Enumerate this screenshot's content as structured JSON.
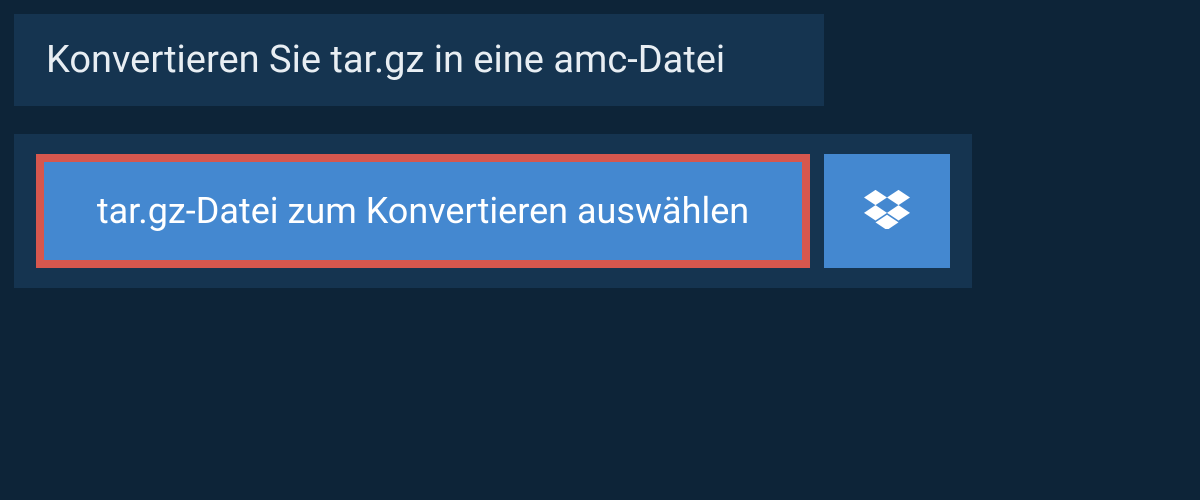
{
  "header": {
    "title": "Konvertieren Sie tar.gz in eine amc-Datei"
  },
  "upload": {
    "select_file_label": "tar.gz-Datei zum Konvertieren auswählen"
  },
  "colors": {
    "page_bg": "#0d2438",
    "panel_bg": "#153450",
    "button_bg": "#4488d0",
    "highlight_border": "#d6574e",
    "text_light": "#e8eef3"
  }
}
